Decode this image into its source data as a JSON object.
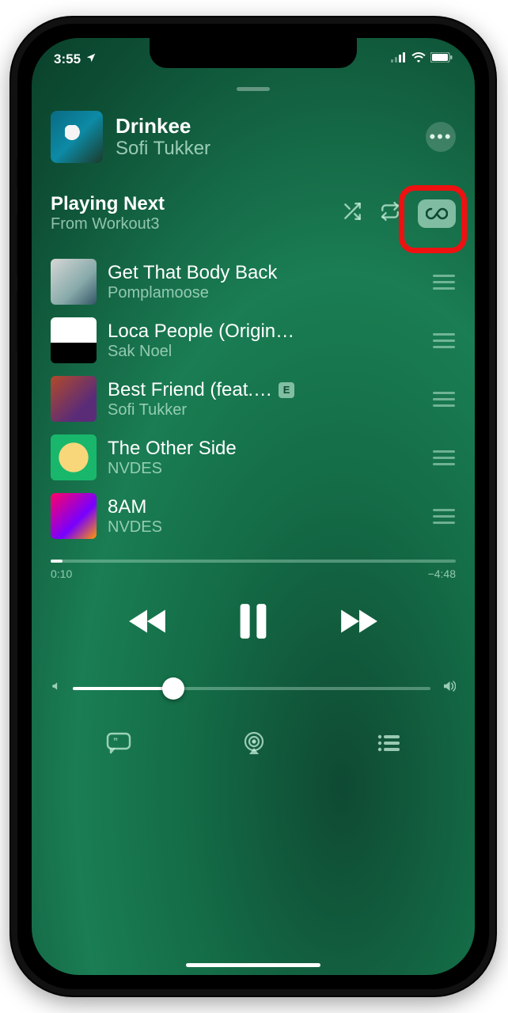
{
  "status": {
    "time": "3:55"
  },
  "now_playing": {
    "title": "Drinkee",
    "artist": "Sofi Tukker"
  },
  "playing_next": {
    "title": "Playing Next",
    "subtitle": "From Workout3"
  },
  "queue": [
    {
      "title": "Get That Body Back",
      "artist": "Pomplamoose",
      "explicit": false
    },
    {
      "title": "Loca People (Origin…",
      "artist": "Sak Noel",
      "explicit": false
    },
    {
      "title": "Best Friend (feat.…",
      "artist": "Sofi Tukker",
      "explicit": true
    },
    {
      "title": "The Other Side",
      "artist": "NVDES",
      "explicit": false
    },
    {
      "title": "8AM",
      "artist": "NVDES",
      "explicit": false
    }
  ],
  "explicit_badge": "E",
  "progress": {
    "elapsed": "0:10",
    "remaining": "−4:48"
  }
}
